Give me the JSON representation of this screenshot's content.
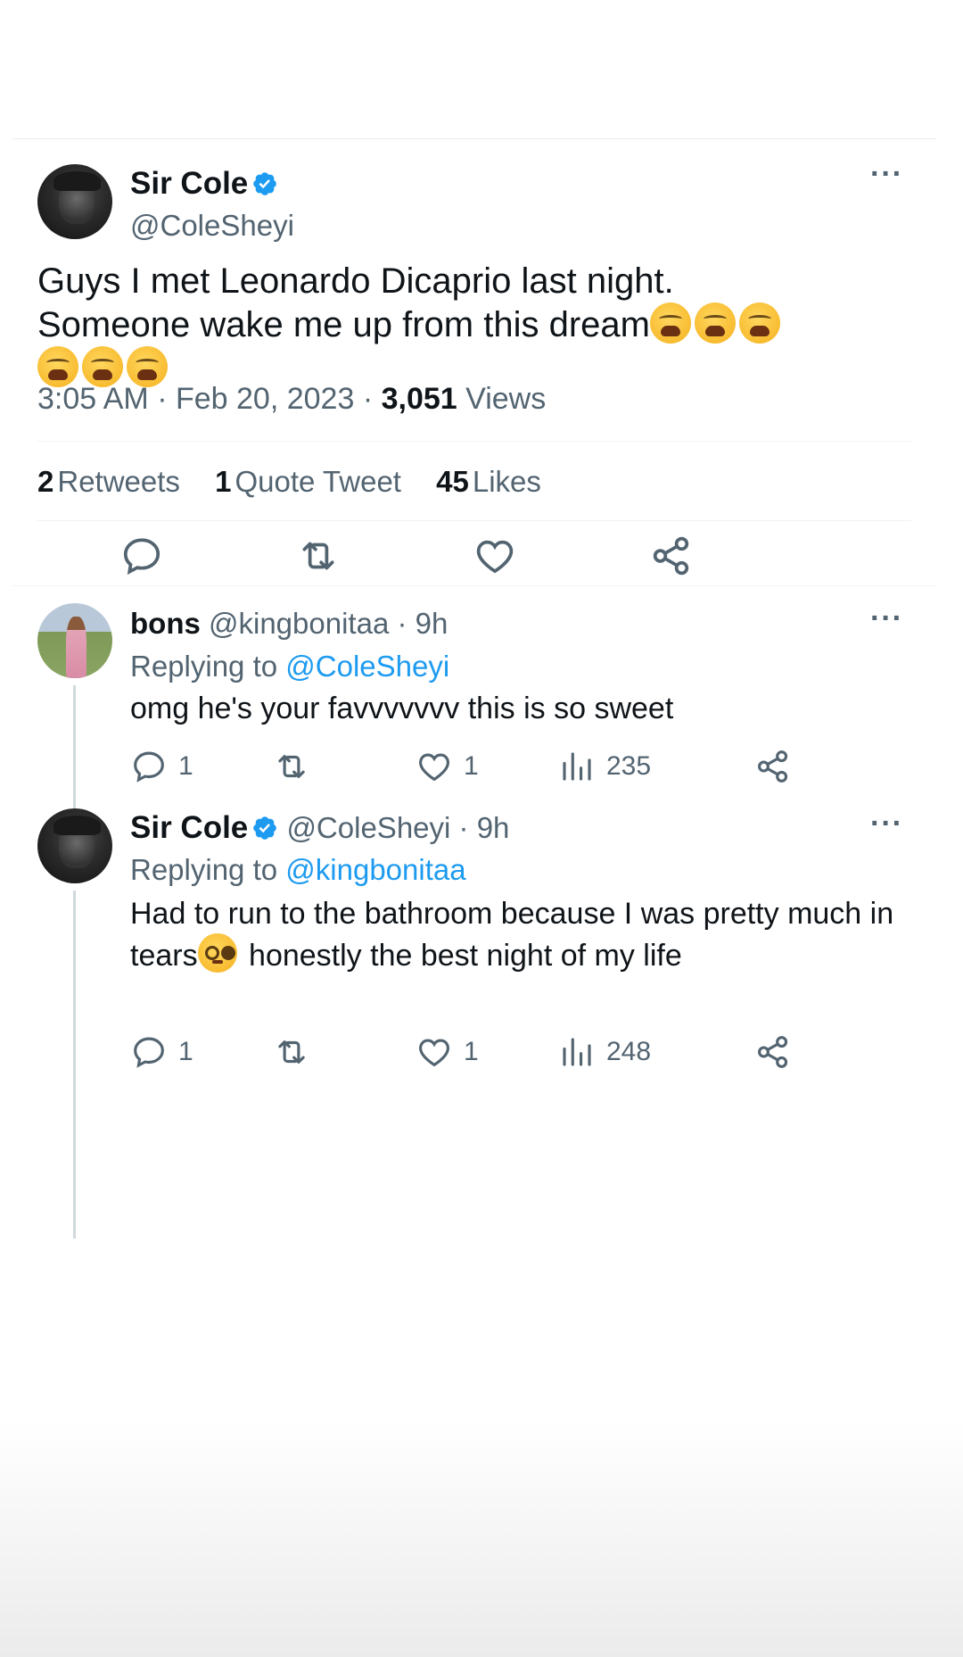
{
  "tweet": {
    "name": "Sir Cole",
    "handle": "@ColeSheyi",
    "text_line1": "Guys I met Leonardo Dicaprio last night.",
    "text_line2": "Someone wake me up from this dream",
    "time": "3:05 AM",
    "date": "Feb 20, 2023",
    "views_count": "3,051",
    "views_label": "Views",
    "retweets_count": "2",
    "retweets_label": "Retweets",
    "quotes_count": "1",
    "quotes_label": "Quote Tweet",
    "likes_count": "45",
    "likes_label": "Likes"
  },
  "replies": [
    {
      "name": "bons",
      "handle": "@kingbonitaa",
      "time": "9h",
      "replying_label": "Replying to",
      "replying_to": "@ColeSheyi",
      "text": "omg he's your favvvvvvv this is so sweet",
      "reply_count": "1",
      "like_count": "1",
      "view_count": "235"
    },
    {
      "name": "Sir Cole",
      "handle": "@ColeSheyi",
      "time": "9h",
      "replying_label": "Replying to",
      "replying_to": "@kingbonitaa",
      "text_part1": "Had to run to the bathroom because I was pretty much in tears",
      "text_part2": " honestly the best night of my life",
      "reply_count": "1",
      "like_count": "1",
      "view_count": "248"
    }
  ],
  "icons": {
    "verified": "verified-badge-icon",
    "more": "more-options-icon",
    "reply": "reply-icon",
    "retweet": "retweet-icon",
    "like": "heart-icon",
    "share": "share-icon",
    "views": "views-chart-icon"
  },
  "colors": {
    "text": "#0f1419",
    "secondary": "#536471",
    "link": "#1d9bf0",
    "verified": "#1d9bf0"
  }
}
